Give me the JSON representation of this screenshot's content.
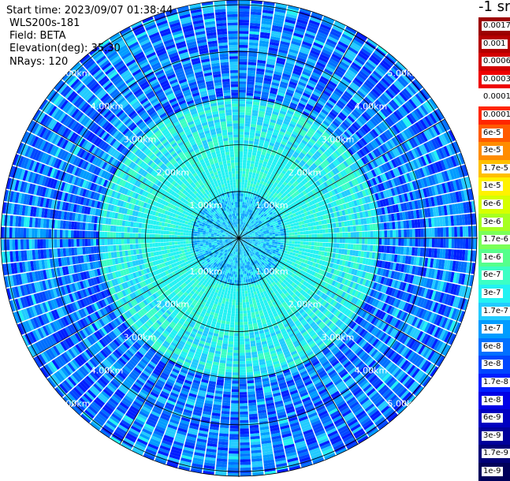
{
  "header": {
    "start_time": "Start time: 2023/09/07 01:38:44",
    "instrument": "WLS200s-181",
    "field": "Field: BETA",
    "elevation": "Elevation(deg): 35.30",
    "nrays": "NRays: 120"
  },
  "colorbar": {
    "title": "-1 sr",
    "labels": [
      "0.0017",
      "0.001",
      "0.0006",
      "0.0003",
      "0.00017",
      "0.0001",
      "6e-5",
      "3e-5",
      "1.7e-5",
      "1e-5",
      "6e-6",
      "3e-6",
      "1.7e-6",
      "1e-6",
      "6e-7",
      "3e-7",
      "1.7e-7",
      "1e-7",
      "6e-8",
      "3e-8",
      "1.7e-8",
      "1e-8",
      "6e-9",
      "3e-9",
      "1.7e-9",
      "1e-9"
    ],
    "colors": [
      "#9c0000",
      "#b40000",
      "#d20000",
      "#ee0000",
      "#ffffff",
      "#ff2600",
      "#ff5a00",
      "#ff8c00",
      "#ffbf00",
      "#fff200",
      "#d6ff00",
      "#a6ff20",
      "#7aff58",
      "#55ff8c",
      "#3bffc4",
      "#22f2f2",
      "#22cbff",
      "#009cff",
      "#0070ff",
      "#0046ff",
      "#001eff",
      "#0000e6",
      "#0000c0",
      "#00009a",
      "#000078",
      "#00005a"
    ]
  },
  "chart_data": {
    "type": "ppi",
    "field": "BETA",
    "units": "-1 sr",
    "elevation_deg": 35.3,
    "n_rays": 120,
    "range_rings_km": [
      1.0,
      2.0,
      3.0,
      4.0,
      5.0
    ],
    "range_labels": [
      "1.00km",
      "2.00km",
      "3.00km",
      "4.00km",
      "5.00km"
    ],
    "spoke_step_deg": 30,
    "field_summary": [
      {
        "range_km": [
          0.0,
          1.0
        ],
        "typical_beta": "1e-7 to 3e-7"
      },
      {
        "range_km": [
          1.0,
          2.0
        ],
        "typical_beta": "3e-7"
      },
      {
        "range_km": [
          2.0,
          3.0
        ],
        "typical_beta": "1.7e-7 to 3e-7"
      },
      {
        "range_km": [
          3.0,
          5.1
        ],
        "typical_beta": "3e-8 to 1e-7"
      }
    ]
  }
}
